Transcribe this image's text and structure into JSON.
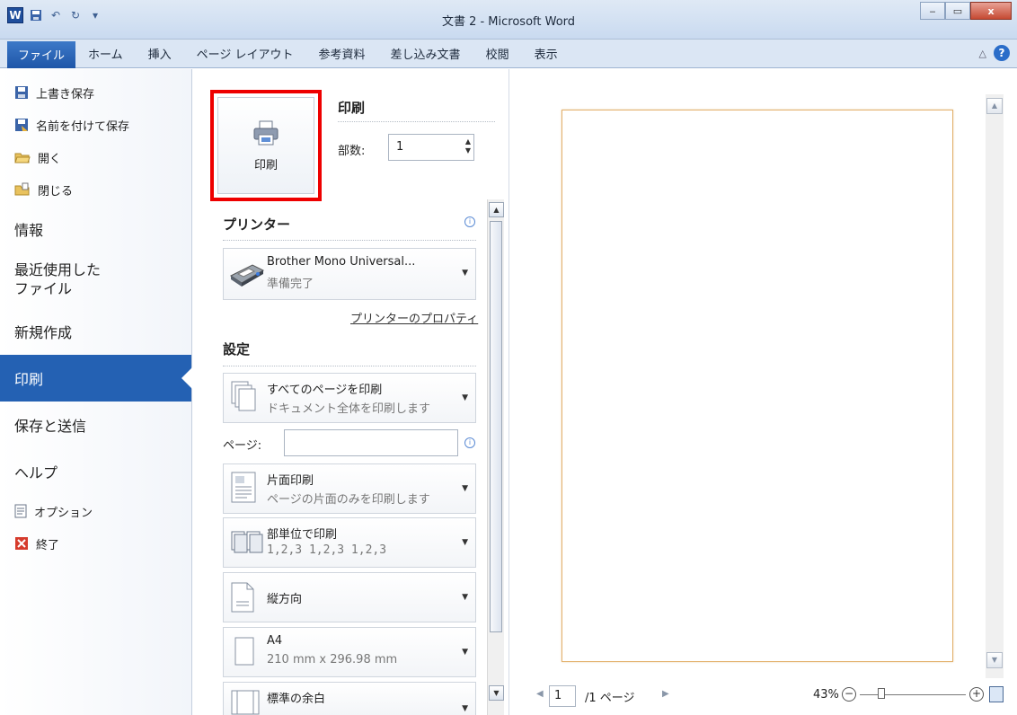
{
  "window": {
    "title": "文書 2 - Microsoft Word",
    "app_logo": "W",
    "quick_access": [
      "save-icon",
      "undo-icon",
      "redo-icon",
      "customize-icon"
    ],
    "buttons": {
      "minimize": "‒",
      "maximize": "▭",
      "close": "x"
    }
  },
  "ribbon": {
    "tabs": [
      "ファイル",
      "ホーム",
      "挿入",
      "ページ レイアウト",
      "参考資料",
      "差し込み文書",
      "校閲",
      "表示"
    ],
    "help": "?"
  },
  "nav": {
    "commands_top": [
      {
        "label": "上書き保存",
        "icon": "save-icon"
      },
      {
        "label": "名前を付けて保存",
        "icon": "save-as-icon"
      },
      {
        "label": "開く",
        "icon": "open-folder-icon"
      },
      {
        "label": "閉じる",
        "icon": "close-folder-icon"
      }
    ],
    "items": [
      "情報",
      "最近使用した\nファイル",
      "新規作成",
      "印刷",
      "保存と送信",
      "ヘルプ"
    ],
    "commands_bottom": [
      {
        "label": "オプション",
        "icon": "options-icon"
      },
      {
        "label": "終了",
        "icon": "exit-icon"
      }
    ],
    "selected": "印刷"
  },
  "print": {
    "button_label": "印刷",
    "section_title": "印刷",
    "copies_label": "部数:",
    "copies_value": "1",
    "printer_title": "プリンター",
    "printer_name": "Brother Mono Universal...",
    "printer_status": "準備完了",
    "printer_properties": "プリンターのプロパティ",
    "settings_title": "設定",
    "pages_label": "ページ:",
    "pages_value": "",
    "settings": [
      {
        "title": "すべてのページを印刷",
        "sub": "ドキュメント全体を印刷します"
      },
      {
        "title": "片面印刷",
        "sub": "ページの片面のみを印刷します"
      },
      {
        "title": "部単位で印刷",
        "sub": "1,2,3   1,2,3   1,2,3"
      },
      {
        "title": "縦方向",
        "sub": ""
      },
      {
        "title": "A4",
        "sub": "210 mm x 296.98 mm"
      },
      {
        "title": "標準の余白",
        "sub": ""
      }
    ]
  },
  "preview": {
    "page_current": "1",
    "page_total": "/1 ページ",
    "zoom": "43%",
    "zoom_level_fraction": 0.2
  },
  "colors": {
    "accent": "#2461b3",
    "highlight_box": "#ee0000",
    "page_border": "#e3b16c"
  }
}
